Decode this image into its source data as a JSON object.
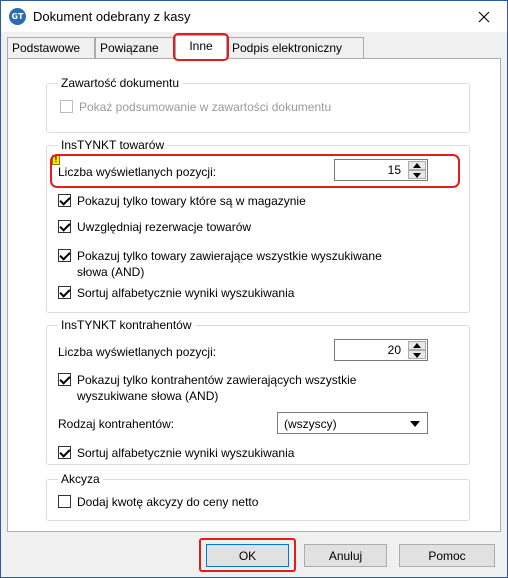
{
  "window": {
    "title": "Dokument odebrany z kasy",
    "app_icon_text": "GT",
    "close_icon": "close-icon"
  },
  "tabs": [
    {
      "label": "Podstawowe",
      "active": false
    },
    {
      "label": "Powiązane",
      "active": false
    },
    {
      "label": "Inne",
      "active": true
    },
    {
      "label": "Podpis elektroniczny",
      "active": false
    }
  ],
  "zawartosc": {
    "legend": "Zawartość dokumentu",
    "show_summary": {
      "label": "Pokaż podsumowanie w zawartości dokumentu",
      "checked": false,
      "enabled": false
    }
  },
  "instynkt_towarow": {
    "legend": "InsTYNKT towarów",
    "count_label": "Liczba wyświetlanych pozycji:",
    "count_value": "15",
    "only_in_stock": {
      "label": "Pokazuj tylko towary które są w magazynie",
      "checked": true
    },
    "include_reservations": {
      "label": "Uwzględniaj rezerwacje towarów",
      "checked": true
    },
    "all_words": {
      "label_line1": "Pokazuj tylko towary zawierające wszystkie wyszukiwane",
      "label_line2": "słowa (AND)",
      "checked": true
    },
    "sort_alpha": {
      "label": "Sortuj alfabetycznie wyniki wyszukiwania",
      "checked": true
    }
  },
  "instynkt_kontrahentow": {
    "legend": "InsTYNKT kontrahentów",
    "count_label": "Liczba wyświetlanych pozycji:",
    "count_value": "20",
    "all_words": {
      "label_line1": "Pokazuj tylko kontrahentów zawierających wszystkie",
      "label_line2": "wyszukiwane słowa (AND)",
      "checked": true
    },
    "type_label": "Rodzaj kontrahentów:",
    "type_value": "(wszyscy)",
    "sort_alpha": {
      "label": "Sortuj alfabetycznie wyniki wyszukiwania",
      "checked": true
    }
  },
  "akcyza": {
    "legend": "Akcyza",
    "add_excise": {
      "label": "Dodaj kwotę akcyzy do ceny netto",
      "checked": false
    }
  },
  "buttons": {
    "ok": "OK",
    "cancel": "Anuluj",
    "help": "Pomoc"
  },
  "colors": {
    "highlight": "#e21d1d",
    "accent": "#0078d7",
    "window_border": "#2b5d9e"
  }
}
